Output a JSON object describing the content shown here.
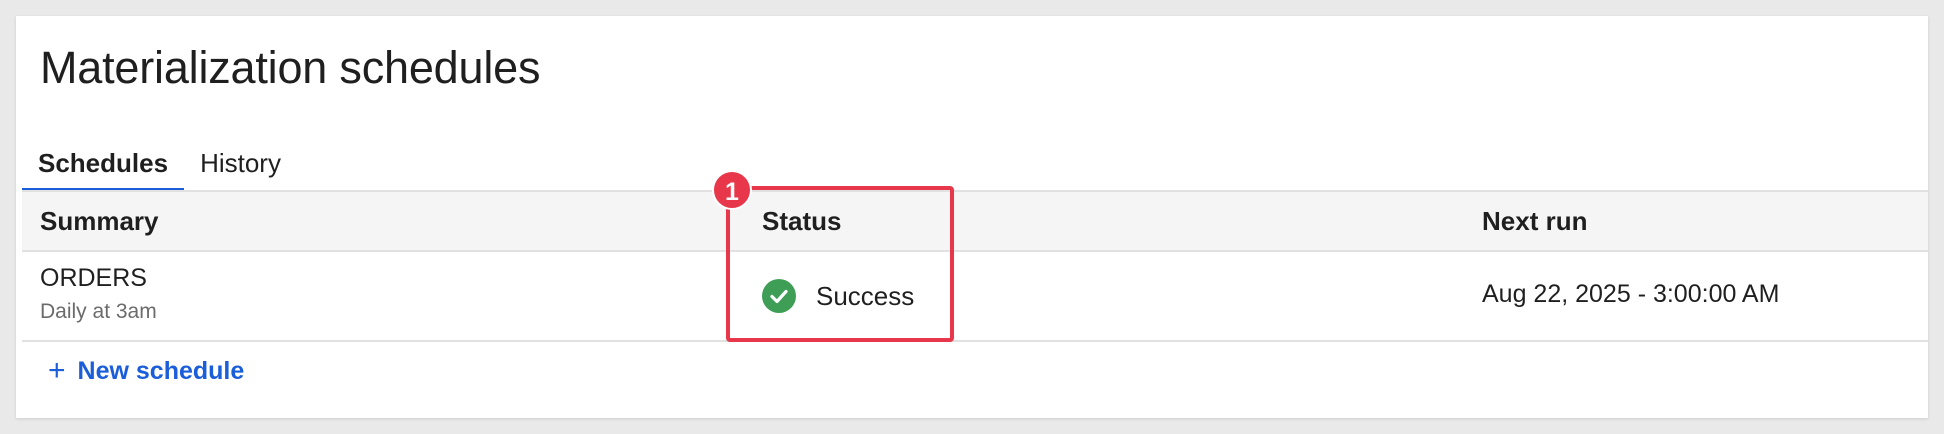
{
  "page": {
    "title": "Materialization schedules"
  },
  "tabs": [
    {
      "label": "Schedules",
      "active": true
    },
    {
      "label": "History",
      "active": false
    }
  ],
  "table": {
    "columns": [
      "Summary",
      "Status",
      "Next run"
    ],
    "rows": [
      {
        "summary_title": "ORDERS",
        "summary_subtitle": "Daily at 3am",
        "status": "Success",
        "status_icon": "check-circle-icon",
        "next_run": "Aug 22, 2025 - 3:00:00 AM"
      }
    ]
  },
  "actions": {
    "new_schedule_label": "New schedule",
    "new_schedule_icon": "plus-icon"
  },
  "annotation": {
    "callout_number": "1",
    "highlight_color": "#e8374a"
  },
  "colors": {
    "accent": "#1a5ed9",
    "success": "#3f9e56"
  }
}
